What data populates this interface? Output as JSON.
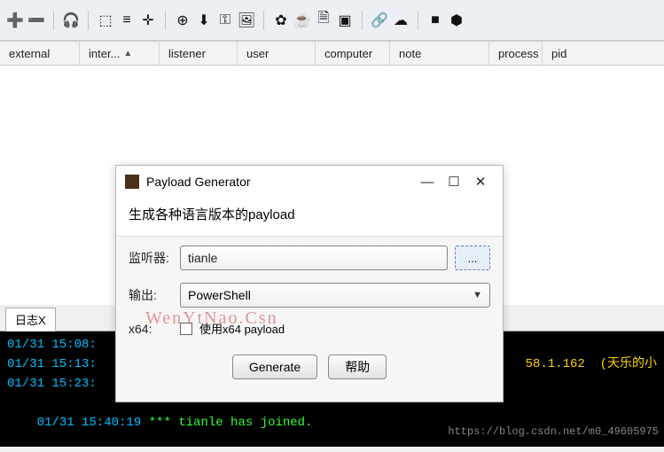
{
  "toolbar_icons": [
    "add-icon",
    "minus-icon",
    "headphones-icon",
    "share-icon",
    "list-icon",
    "target-icon",
    "zoom-icon",
    "download-icon",
    "key-icon",
    "image-icon",
    "gear-icon",
    "coffee-icon",
    "file-icon",
    "terminal-icon",
    "link-icon",
    "cloud-icon",
    "book-icon",
    "box-icon"
  ],
  "columns": {
    "external": "external",
    "inter": "inter...",
    "listener": "listener",
    "user": "user",
    "computer": "computer",
    "note": "note",
    "process": "process",
    "pid": "pid"
  },
  "tab": "日志X",
  "terminal": {
    "l1": "01/31 15:08:",
    "l2": "01/31 15:13:",
    "l3": "01/31 15:23:",
    "l4_time": "01/31 15:40:19 ",
    "l4_msg": "*** tianle has joined.",
    "r2": "58.1.162  (天乐的小"
  },
  "dialog": {
    "title": "Payload Generator",
    "desc": "生成各种语言版本的payload",
    "listener_label": "监听器:",
    "listener_value": "tianle",
    "browse": "...",
    "output_label": "输出:",
    "output_value": "PowerShell",
    "x64_label": "x64:",
    "x64_check": "使用x64 payload",
    "generate": "Generate",
    "help": "帮助"
  },
  "watermark": "WenYtNao.Csn",
  "wm_url": "https://blog.csdn.net/m0_49605975"
}
